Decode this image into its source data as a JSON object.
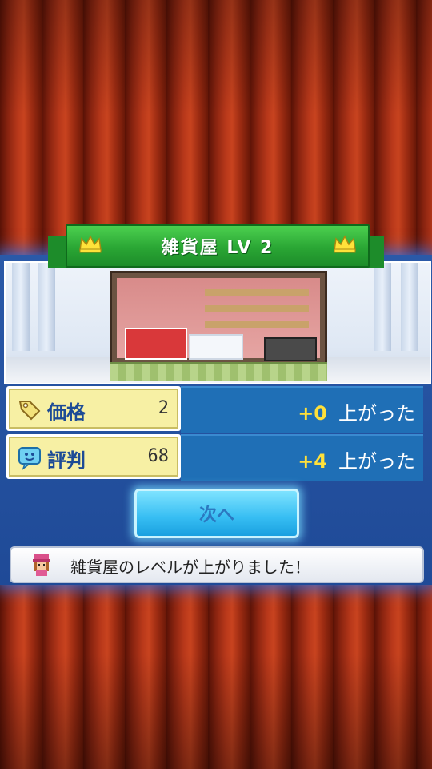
{
  "banner": {
    "title": "雑貨屋 LV 2"
  },
  "stats": [
    {
      "label": "価格",
      "value": "2",
      "gain": "+0",
      "gain_text": "上がった",
      "icon": "price-tag-icon"
    },
    {
      "label": "評判",
      "value": "68",
      "gain": "+4",
      "gain_text": "上がった",
      "icon": "reputation-face-icon"
    }
  ],
  "next_button": {
    "label": "次へ"
  },
  "message": {
    "text": "雑貨屋のレベルが上がりました！",
    "icon": "staff-avatar-icon"
  },
  "colors": {
    "banner_green": "#2aa634",
    "panel_blue": "#1f4a97",
    "stat_yellow": "#f7f0a4",
    "gain_yellow": "#ffe03a",
    "button_cyan": "#36bdf2",
    "curtain_red": "#b8381a"
  }
}
